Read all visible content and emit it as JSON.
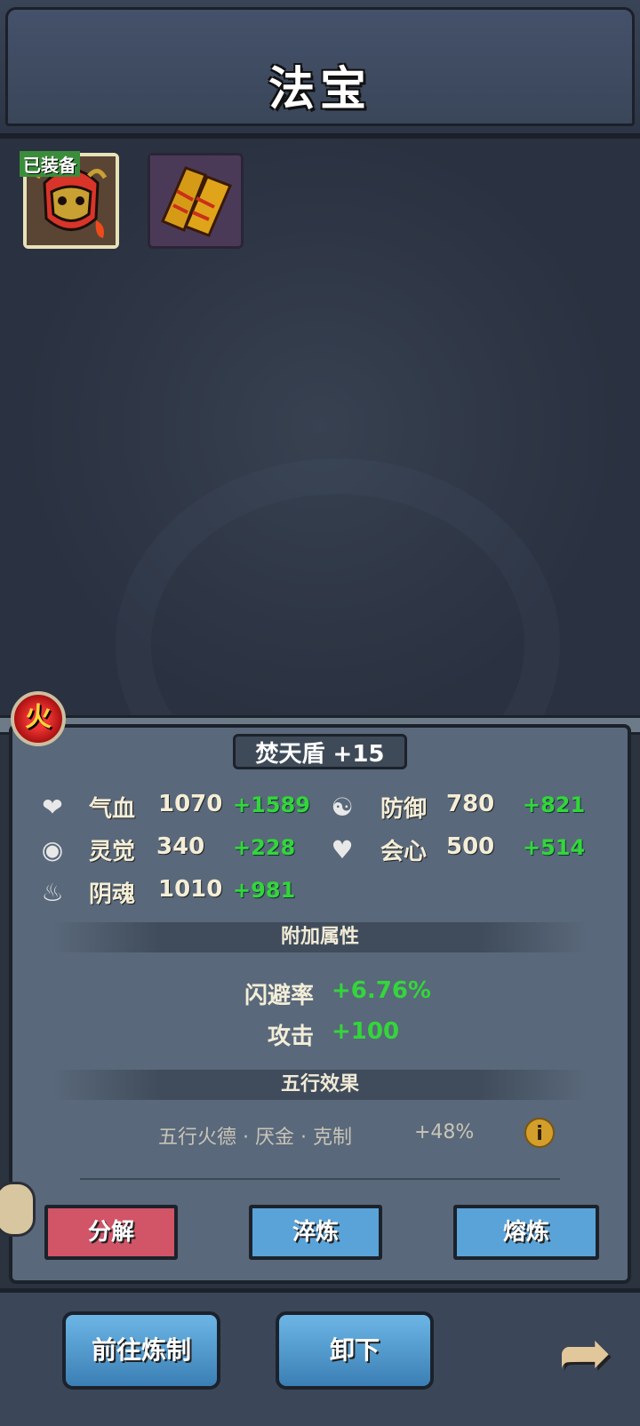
{
  "header": {
    "title": "法宝"
  },
  "slots": [
    {
      "badge": "已装备"
    },
    {
      "badge": ""
    }
  ],
  "element": {
    "label": "火"
  },
  "item": {
    "name": "焚天盾 +15"
  },
  "stats": [
    {
      "icon": "heart-icon",
      "label": "气血",
      "value": "1070",
      "bonus": "+1589"
    },
    {
      "icon": "yin-yang-icon",
      "label": "防御",
      "value": "780",
      "bonus": "+821"
    },
    {
      "icon": "eye-icon",
      "label": "灵觉",
      "value": "340",
      "bonus": "+228"
    },
    {
      "icon": "heart-cross-icon",
      "label": "会心",
      "value": "500",
      "bonus": "+514"
    },
    {
      "icon": "spirit-flame-icon",
      "label": "阴魂",
      "value": "1010",
      "bonus": "+981"
    }
  ],
  "extra_section": {
    "title": "附加属性"
  },
  "extra": [
    {
      "label": "闪避率",
      "value": "+6.76%"
    },
    {
      "label": "攻击",
      "value": "+100"
    }
  ],
  "five_section": {
    "title": "五行效果"
  },
  "five_effect": {
    "text": "五行火德 · 厌金 · 克制",
    "value": "+48%"
  },
  "actions": {
    "decompose": "分解",
    "temper": "淬炼",
    "smelt": "熔炼"
  },
  "bottom": {
    "goto_forge": "前往炼制",
    "unequip": "卸下"
  },
  "colors": {
    "bonus": "#33d63a",
    "accent_red": "#d15467",
    "accent_blue": "#5aa3d9"
  }
}
